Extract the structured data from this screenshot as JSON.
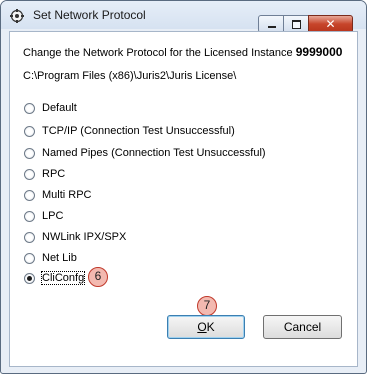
{
  "window": {
    "title": "Set Network Protocol",
    "close_glyph": "✕"
  },
  "header": {
    "change_text": "Change the Network Protocol for the Licensed Instance ",
    "instance_number": "9999000",
    "path": "C:\\Program Files (x86)\\Juris2\\Juris License\\"
  },
  "protocols": [
    {
      "label": "Default",
      "checked": false
    },
    {
      "label": "TCP/IP (Connection Test Unsuccessful)",
      "checked": false
    },
    {
      "label": "Named Pipes (Connection Test Unsuccessful)",
      "checked": false
    },
    {
      "label": "RPC",
      "checked": false
    },
    {
      "label": "Multi RPC",
      "checked": false
    },
    {
      "label": "LPC",
      "checked": false
    },
    {
      "label": "NWLink IPX/SPX",
      "checked": false
    },
    {
      "label": "Net Lib",
      "checked": false
    },
    {
      "label": "CliConfg",
      "checked": true
    }
  ],
  "badges": {
    "step6": "6",
    "step7": "7"
  },
  "buttons": {
    "ok_mnemonic": "O",
    "ok_rest": "K",
    "cancel": "Cancel"
  },
  "colors": {
    "badge_fill": "#f3b9b0",
    "badge_border": "#c0392b",
    "close_button": "#c7452b"
  }
}
